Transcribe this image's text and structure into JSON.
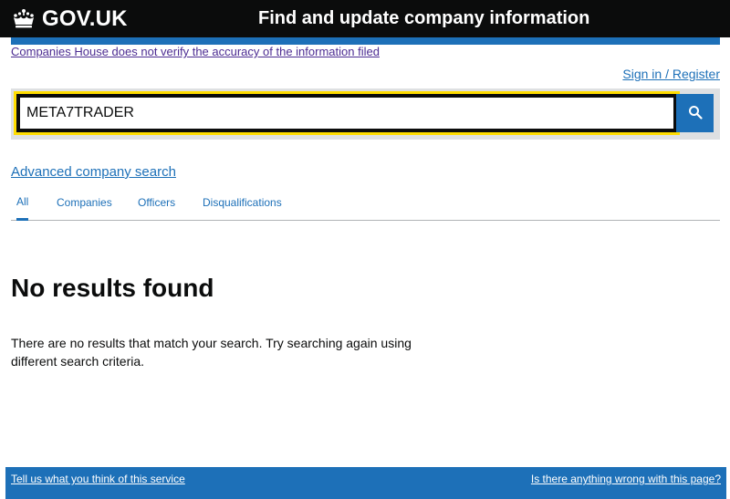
{
  "header": {
    "brand": "GOV.UK",
    "service_name": "Find and update company information",
    "crown_icon": "crown-icon"
  },
  "banner": {
    "disclaimer": "Companies House does not verify the accuracy of the information filed"
  },
  "account": {
    "signin_label": "Sign in / Register"
  },
  "search": {
    "value": "META7TRADER",
    "button_icon": "search-icon"
  },
  "advanced_search": {
    "label": "Advanced company search"
  },
  "tabs": [
    {
      "label": "All",
      "active": true
    },
    {
      "label": "Companies",
      "active": false
    },
    {
      "label": "Officers",
      "active": false
    },
    {
      "label": "Disqualifications",
      "active": false
    }
  ],
  "results": {
    "heading": "No results found",
    "message": "There are no results that match your search. Try searching again using different search criteria."
  },
  "footer": {
    "feedback_link": "Tell us what you think of this service",
    "report_link": "Is there anything wrong with this page?"
  },
  "colors": {
    "header_bg": "#0b0c0c",
    "link_blue": "#1d70b8",
    "visited_purple": "#4c2c92",
    "focus_yellow": "#ffdd00",
    "search_panel_bg": "#dee0e2"
  }
}
